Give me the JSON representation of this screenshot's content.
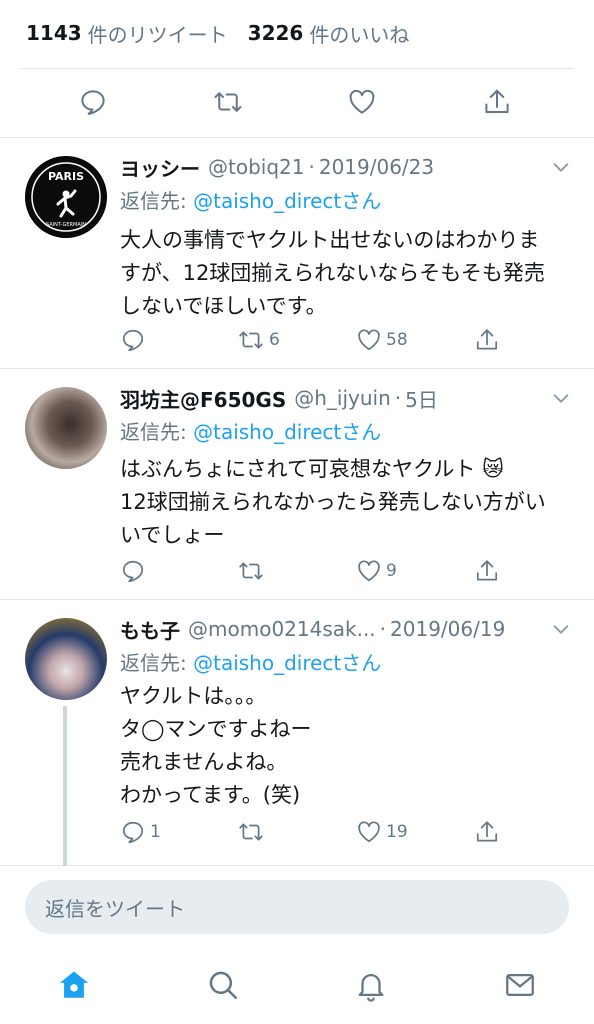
{
  "stats": {
    "retweets_count": "1143",
    "retweets_label": "件のリツイート",
    "likes_count": "3226",
    "likes_label": "件のいいね"
  },
  "icons": {
    "main_reply": "reply-icon",
    "main_retweet": "retweet-icon",
    "main_like": "heart-icon",
    "main_share": "share-icon"
  },
  "replies": [
    {
      "name": "ヨッシー",
      "handle": "@tobiq21",
      "sep": "·",
      "date": "2019/06/23",
      "reply_prefix": "返信先: ",
      "reply_to": "@taisho_directさん",
      "lines": [
        "大人の事情でヤクルト出せないのはわかりま",
        "すが、12球団揃えられないならそもそも発売",
        "しないでほしいです。"
      ],
      "reply_count": "",
      "retweet_count": "6",
      "like_count": "58",
      "avatar_text": "PARIS"
    },
    {
      "name": "羽坊主@F650GS",
      "handle": "@h_ijyuin",
      "sep": "·",
      "date": "5日",
      "reply_prefix": "返信先: ",
      "reply_to": "@taisho_directさん",
      "lines": [
        "はぶんちょにされて可哀想なヤクルト 😿",
        "12球団揃えられなかったら発売しない方がい",
        "いでしょー"
      ],
      "reply_count": "",
      "retweet_count": "",
      "like_count": "9"
    },
    {
      "name": "もも子",
      "handle": "@momo0214sak...",
      "sep": "·",
      "date": "2019/06/19",
      "reply_prefix": "返信先: ",
      "reply_to": "@taisho_directさん",
      "lines": [
        "ヤクルトは。。。",
        "タ◯マンですよねー",
        "売れませんよね。",
        "わかってます。(笑)"
      ],
      "reply_count": "1",
      "retweet_count": "",
      "like_count": "19"
    }
  ],
  "compose": {
    "placeholder": "返信をツイート"
  },
  "tabbar": [
    "home-icon",
    "search-icon",
    "notifications-icon",
    "messages-icon"
  ],
  "colors": {
    "accent": "#1da1f2",
    "muted": "#657786",
    "divider": "#e1e8ed"
  }
}
